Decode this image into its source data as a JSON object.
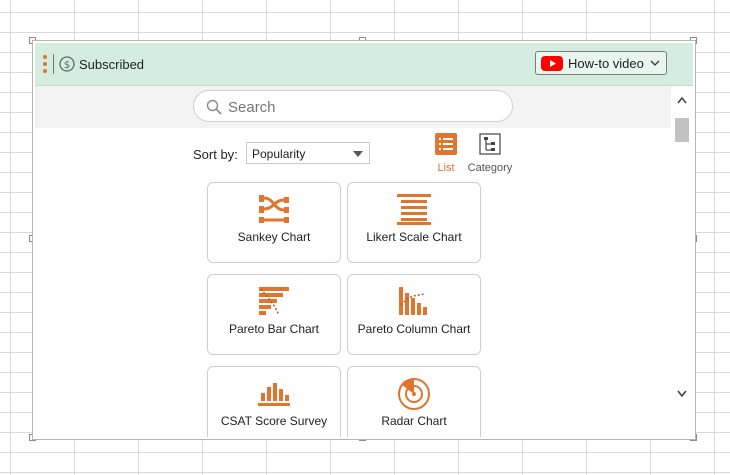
{
  "header": {
    "subscription_label": "Subscribed",
    "howto_label": "How-to video",
    "accent_color": "#e0762d",
    "header_bg": "#d4ede0"
  },
  "search": {
    "placeholder": "Search"
  },
  "sort": {
    "label": "Sort by:",
    "selected": "Popularity"
  },
  "view": {
    "list_label": "List",
    "category_label": "Category",
    "active": "List"
  },
  "charts": [
    {
      "label": "Sankey Chart",
      "icon": "sankey-icon"
    },
    {
      "label": "Likert Scale Chart",
      "icon": "likert-icon"
    },
    {
      "label": "Pareto Bar Chart",
      "icon": "pareto-bar-icon"
    },
    {
      "label": "Pareto Column Chart",
      "icon": "pareto-column-icon"
    },
    {
      "label": "CSAT Score Survey",
      "icon": "csat-icon"
    },
    {
      "label": "Radar Chart",
      "icon": "radar-icon"
    }
  ]
}
